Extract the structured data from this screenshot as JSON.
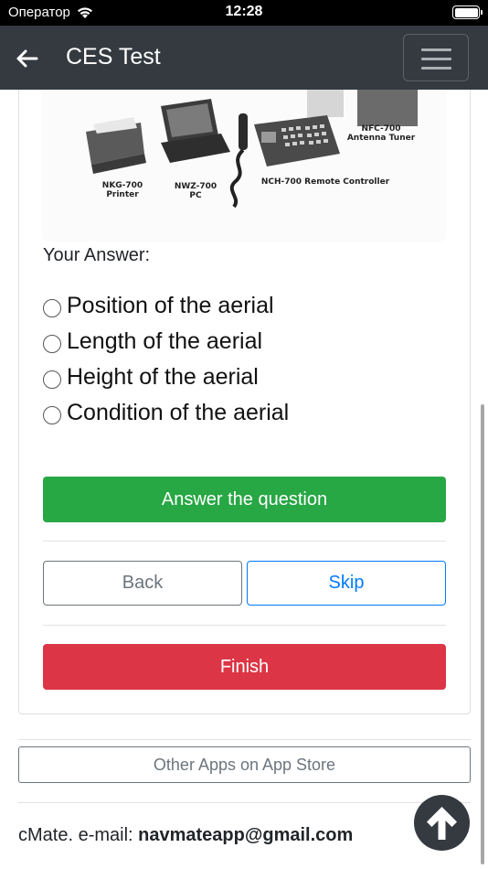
{
  "status_bar": {
    "carrier": "Оператор",
    "time": "12:28",
    "wifi_icon": "wifi-icon",
    "battery_icon": "battery-icon",
    "battery_level": 1.0
  },
  "navbar": {
    "title": "CES Test",
    "back_icon": "arrow-left-icon",
    "menu_icon": "hamburger-icon"
  },
  "figure": {
    "labels": {
      "nfc": "NFC-700\nAntenna Tuner",
      "nch": "NCH-700 Remote Controller",
      "nkg": "NKG-700\nPrinter",
      "nwz": "NWZ-700\nPC"
    }
  },
  "question": {
    "answer_label": "Your Answer:",
    "options": [
      "Position of the aerial",
      "Length of the aerial",
      "Height of the aerial",
      "Condition of the aerial"
    ]
  },
  "buttons": {
    "answer": "Answer the question",
    "back": "Back",
    "skip": "Skip",
    "finish": "Finish",
    "other_apps": "Other Apps on App Store"
  },
  "footer": {
    "prefix": "cMate. e-mail: ",
    "email": "navmateapp@gmail.com"
  },
  "colors": {
    "navbar": "#343a40",
    "success": "#28a745",
    "danger": "#dc3545",
    "primary": "#007bff",
    "secondary": "#6c757d"
  },
  "scroll_top_icon": "arrow-up-circle-icon"
}
